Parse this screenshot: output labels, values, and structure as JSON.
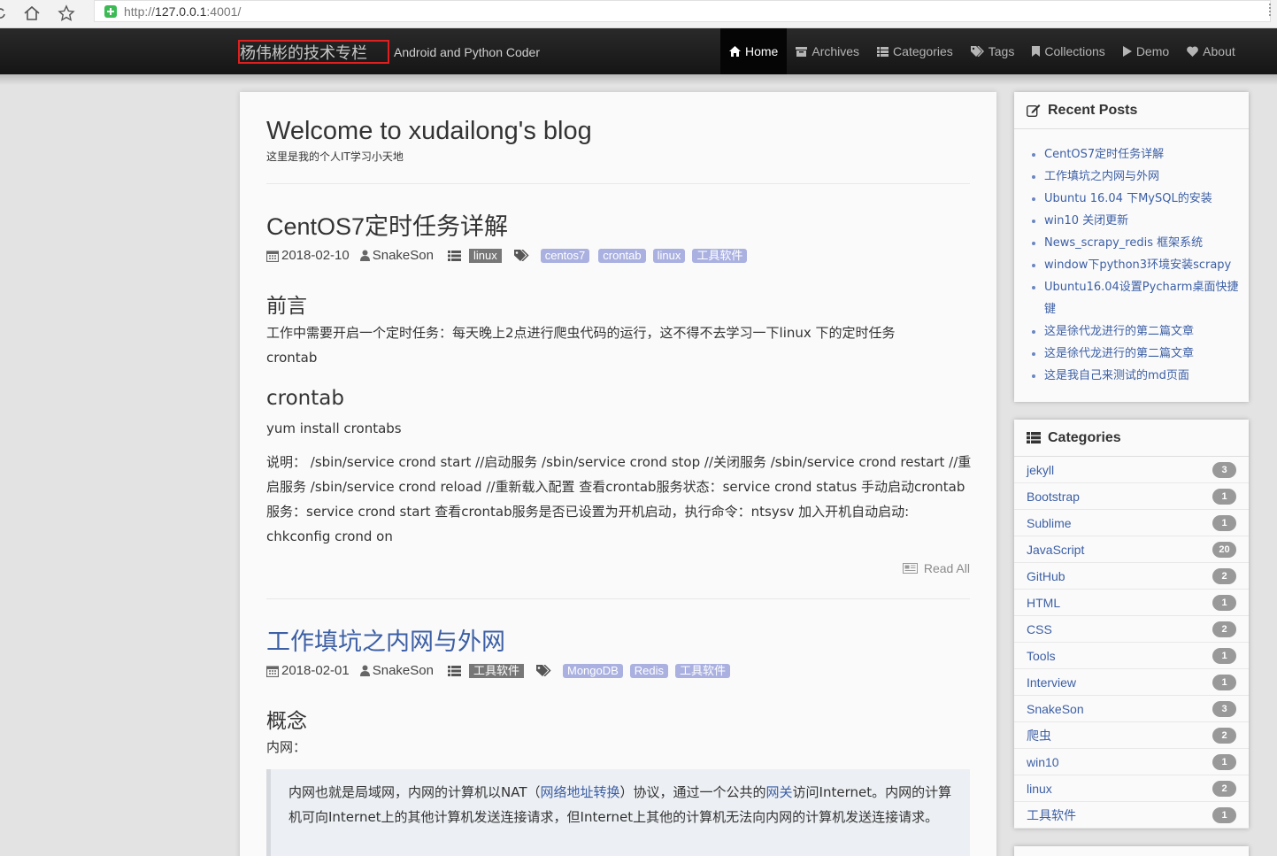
{
  "browser": {
    "url_prefix": "http://",
    "url_host": "127.0.0.1",
    "url_rest": ":4001/"
  },
  "header": {
    "brand": "杨伟彬的技术专栏",
    "tagline": "Android and Python Coder",
    "menu": [
      {
        "label": "Home",
        "icon": "home-icon"
      },
      {
        "label": "Archives",
        "icon": "archive-icon"
      },
      {
        "label": "Categories",
        "icon": "list-icon"
      },
      {
        "label": "Tags",
        "icon": "tags-icon"
      },
      {
        "label": "Collections",
        "icon": "bookmark-icon"
      },
      {
        "label": "Demo",
        "icon": "play-icon"
      },
      {
        "label": "About",
        "icon": "heart-icon"
      }
    ]
  },
  "main": {
    "title": "Welcome to xudailong's blog",
    "subtitle": "这里是我的个人IT学习小天地",
    "posts": [
      {
        "title": "CentOS7定时任务详解",
        "date": "2018-02-10",
        "author": "SnakeSon",
        "category": "linux",
        "tags": [
          "centos7",
          "crontab",
          "linux",
          "工具软件"
        ],
        "sections": [
          {
            "heading": "前言",
            "text": "工作中需要开启一个定时任务：每天晚上2点进行爬虫代码的运行，这不得不去学习一下linux 下的定时任务crontab"
          },
          {
            "heading": "crontab",
            "text": "yum install crontabs"
          }
        ],
        "explain": "说明： /sbin/service crond start //启动服务 /sbin/service crond stop //关闭服务 /sbin/service crond restart //重启服务 /sbin/service crond reload //重新载入配置 查看crontab服务状态：service crond status 手动启动crontab服务：service crond start 查看crontab服务是否已设置为开机启动，执行命令：ntsysv 加入开机自动启动: chkconfig crond on",
        "read_all": "Read All"
      },
      {
        "title": "工作填坑之内网与外网",
        "date": "2018-02-01",
        "author": "SnakeSon",
        "category": "工具软件",
        "tags": [
          "MongoDB",
          "Redis",
          "工具软件"
        ],
        "heading": "概念",
        "label": "内网：",
        "quote_a": "内网也就是局域网，内网的计算机以NAT（",
        "quote_link1": "网络地址转换",
        "quote_b": "）协议，通过一个公共的",
        "quote_link2": "网关",
        "quote_c": "访问Internet。内网的计算机可向Internet上的其他计算机发送连接请求，但Internet上其他的计算机无法向内网的计算机发送连接请求。"
      }
    ]
  },
  "sidebar": {
    "recent_title": "Recent Posts",
    "recent_posts": [
      "CentOS7定时任务详解",
      "工作填坑之内网与外网",
      "Ubuntu 16.04 下MySQL的安装",
      "win10 关闭更新",
      "News_scrapy_redis 框架系统",
      "window下python3环境安装scrapy",
      "Ubuntu16.04设置Pycharm桌面快捷键",
      "这是徐代龙进行的第二篇文章",
      "这是徐代龙进行的第二篇文章",
      "这是我自己来测试的md页面"
    ],
    "categories_title": "Categories",
    "categories": [
      {
        "name": "jekyll",
        "count": "3"
      },
      {
        "name": "Bootstrap",
        "count": "1"
      },
      {
        "name": "Sublime",
        "count": "1"
      },
      {
        "name": "JavaScript",
        "count": "20"
      },
      {
        "name": "GitHub",
        "count": "2"
      },
      {
        "name": "HTML",
        "count": "1"
      },
      {
        "name": "CSS",
        "count": "2"
      },
      {
        "name": "Tools",
        "count": "1"
      },
      {
        "name": "Interview",
        "count": "1"
      },
      {
        "name": "SnakeSon",
        "count": "3"
      },
      {
        "name": "爬虫",
        "count": "2"
      },
      {
        "name": "win10",
        "count": "1"
      },
      {
        "name": "linux",
        "count": "2"
      },
      {
        "name": "工具软件",
        "count": "1"
      }
    ]
  },
  "colors": {
    "link": "#3c5fa5",
    "tag": "#aab1e0",
    "brand_box": "#e02020"
  }
}
